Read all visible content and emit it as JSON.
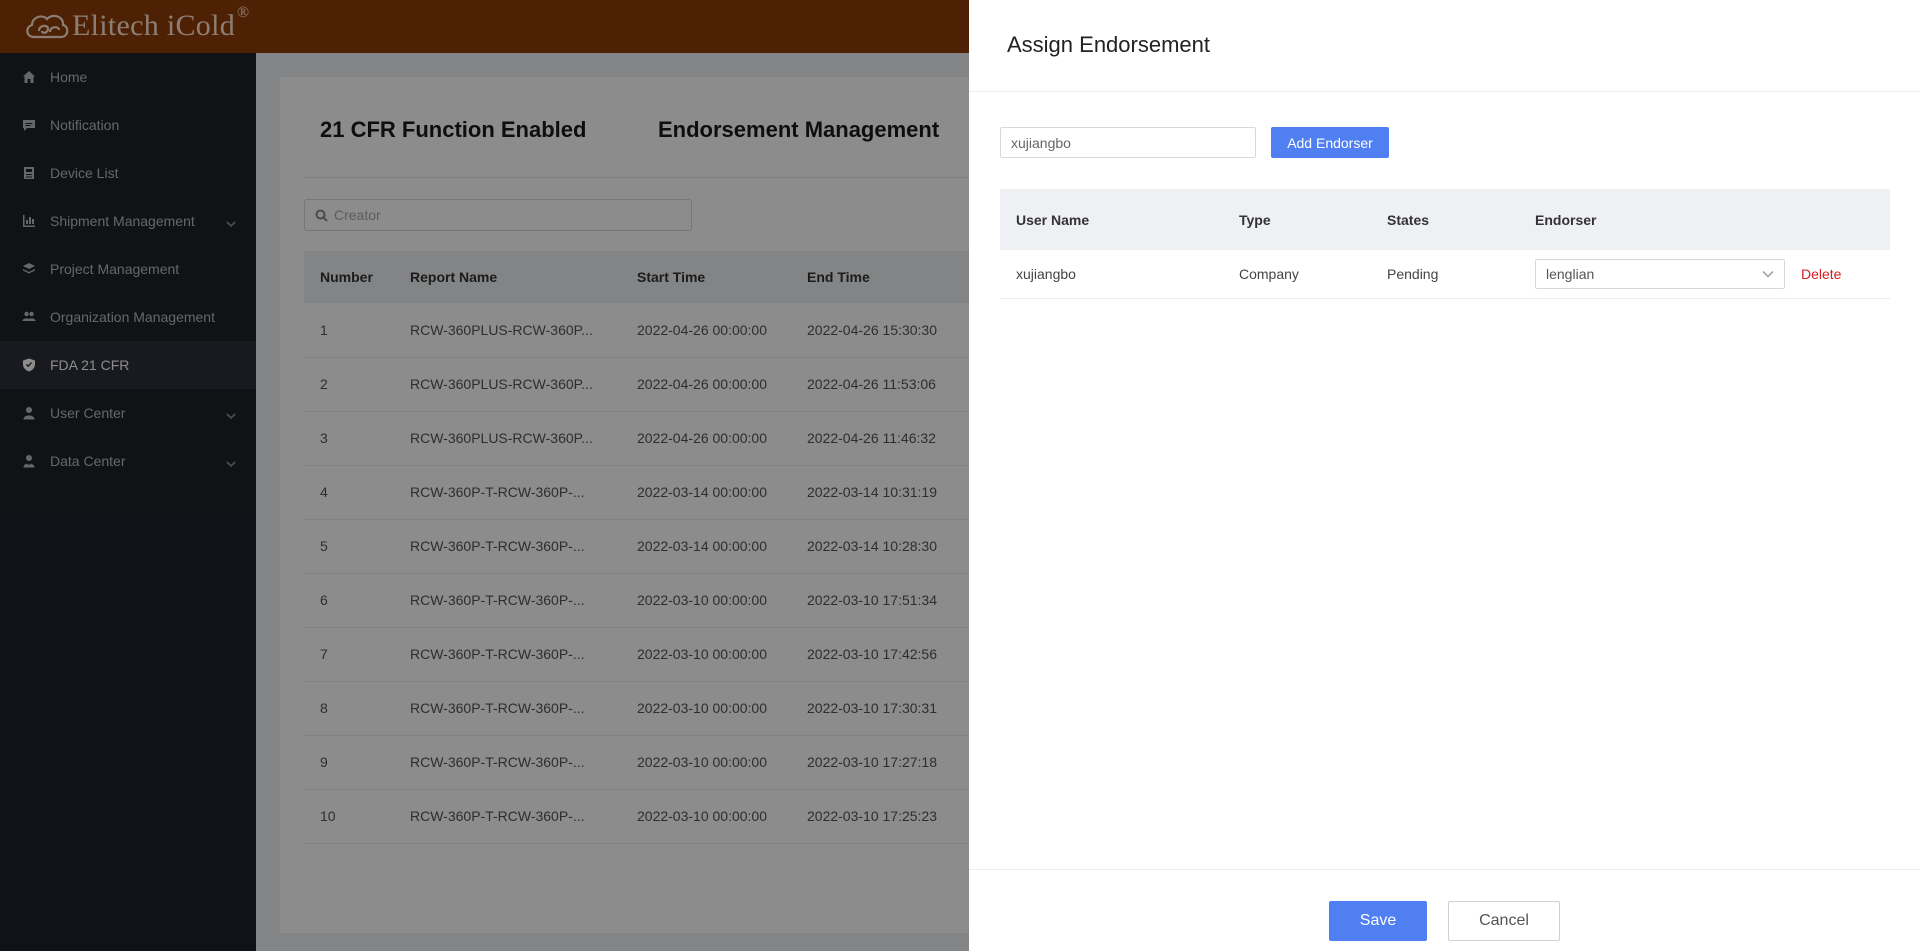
{
  "header": {
    "brand": "Elitech iCold",
    "reg_mark": "®"
  },
  "sidebar": {
    "items": [
      {
        "label": "Home",
        "icon": "home-icon",
        "expandable": false,
        "active": false
      },
      {
        "label": "Notification",
        "icon": "message-icon",
        "expandable": false,
        "active": false
      },
      {
        "label": "Device List",
        "icon": "device-icon",
        "expandable": false,
        "active": false
      },
      {
        "label": "Shipment Management",
        "icon": "shipment-icon",
        "expandable": true,
        "active": false
      },
      {
        "label": "Project Management",
        "icon": "layers-icon",
        "expandable": false,
        "active": false
      },
      {
        "label": "Organization Management",
        "icon": "organization-icon",
        "expandable": false,
        "active": false
      },
      {
        "label": "FDA 21 CFR",
        "icon": "shield-check-icon",
        "expandable": false,
        "active": true
      },
      {
        "label": "User Center",
        "icon": "user-icon",
        "expandable": true,
        "active": false
      },
      {
        "label": "Data Center",
        "icon": "data-center-icon",
        "expandable": true,
        "active": false
      }
    ]
  },
  "main": {
    "title_left": "21 CFR Function Enabled",
    "title_right": "Endorsement Management",
    "search_placeholder": "Creator",
    "columns": [
      "Number",
      "Report Name",
      "Start Time",
      "End Time"
    ],
    "rows": [
      [
        "1",
        "RCW-360PLUS-RCW-360P...",
        "2022-04-26 00:00:00",
        "2022-04-26 15:30:30"
      ],
      [
        "2",
        "RCW-360PLUS-RCW-360P...",
        "2022-04-26 00:00:00",
        "2022-04-26 11:53:06"
      ],
      [
        "3",
        "RCW-360PLUS-RCW-360P...",
        "2022-04-26 00:00:00",
        "2022-04-26 11:46:32"
      ],
      [
        "4",
        "RCW-360P-T-RCW-360P-...",
        "2022-03-14 00:00:00",
        "2022-03-14 10:31:19"
      ],
      [
        "5",
        "RCW-360P-T-RCW-360P-...",
        "2022-03-14 00:00:00",
        "2022-03-14 10:28:30"
      ],
      [
        "6",
        "RCW-360P-T-RCW-360P-...",
        "2022-03-10 00:00:00",
        "2022-03-10 17:51:34"
      ],
      [
        "7",
        "RCW-360P-T-RCW-360P-...",
        "2022-03-10 00:00:00",
        "2022-03-10 17:42:56"
      ],
      [
        "8",
        "RCW-360P-T-RCW-360P-...",
        "2022-03-10 00:00:00",
        "2022-03-10 17:30:31"
      ],
      [
        "9",
        "RCW-360P-T-RCW-360P-...",
        "2022-03-10 00:00:00",
        "2022-03-10 17:27:18"
      ],
      [
        "10",
        "RCW-360P-T-RCW-360P-...",
        "2022-03-10 00:00:00",
        "2022-03-10 17:25:23"
      ]
    ]
  },
  "drawer": {
    "title": "Assign Endorsement",
    "user_input_value": "xujiangbo",
    "add_button": "Add Endorser",
    "columns": {
      "user_name": "User Name",
      "type": "Type",
      "states": "States",
      "endorser": "Endorser"
    },
    "rows": [
      {
        "user_name": "xujiangbo",
        "type": "Company",
        "state": "Pending",
        "endorser": "lenglian",
        "action": "Delete"
      }
    ],
    "save_button": "Save",
    "cancel_button": "Cancel"
  },
  "colors": {
    "header_bg": "#8f3d09",
    "sidebar_bg": "#1e2129",
    "primary": "#4f7ff0",
    "danger": "#d02020"
  }
}
